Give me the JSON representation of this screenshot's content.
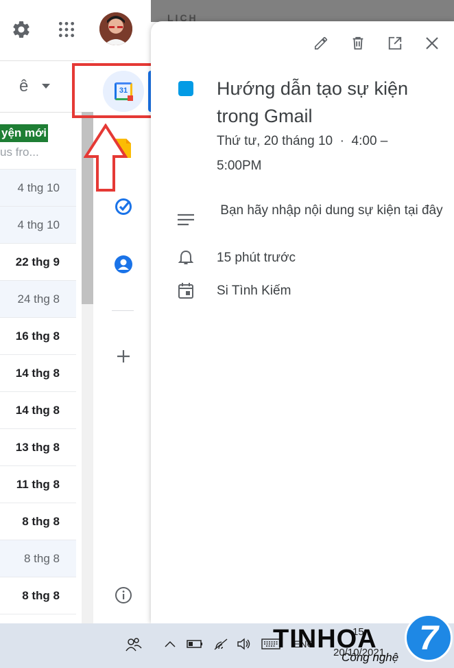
{
  "gmail_header": {
    "settings_icon": "gear-icon",
    "apps_icon": "apps-grid-icon",
    "avatar_icon": "user-avatar",
    "input_tools_label": "ê",
    "input_tools_dropdown_icon": "caret-down-icon"
  },
  "email_list": {
    "label_badge": "yện mới",
    "snippet": "us fro...",
    "rows": [
      {
        "date": "4 thg 10",
        "bold": false
      },
      {
        "date": "4 thg 10",
        "bold": false
      },
      {
        "date": "22 thg 9",
        "bold": true
      },
      {
        "date": "24 thg 8",
        "bold": false
      },
      {
        "date": "16 thg 8",
        "bold": true
      },
      {
        "date": "14 thg 8",
        "bold": true
      },
      {
        "date": "14 thg 8",
        "bold": true
      },
      {
        "date": "13 thg 8",
        "bold": true
      },
      {
        "date": "11 thg 8",
        "bold": true
      },
      {
        "date": "8 thg 8",
        "bold": true
      },
      {
        "date": "8 thg 8",
        "bold": false
      },
      {
        "date": "8 thg 8",
        "bold": true
      }
    ]
  },
  "side_panel": {
    "calendar_icon_label": "31",
    "apps": [
      "google-calendar-icon",
      "google-keep-icon",
      "google-tasks-icon",
      "google-contacts-icon"
    ],
    "add_icon": "plus-icon",
    "info_icon": "info-icon"
  },
  "panel_header": {
    "title": "LỊCH"
  },
  "event": {
    "title": "Hướng dẫn tạo sự kiện trong Gmail",
    "color": "#039be5",
    "datetime_line1": "Thứ tư, 20 tháng 10  ·  4:00 –",
    "datetime_line2": "5:00PM",
    "description": " Bạn hãy nhập nội dung sự kiện tại đây",
    "reminder": "15 phút trước",
    "calendar_owner": "Si Tình Kiếm",
    "actions": [
      "edit-icon",
      "delete-icon",
      "open-in-new-icon",
      "close-icon"
    ]
  },
  "taskbar": {
    "brand_text": "TINHOA",
    "brand_number": "7",
    "brand_subtitle": "Công nghệ",
    "tray_time": "15:",
    "tray_date": "20/10/2021",
    "tray_lang": "ENG"
  },
  "annotation": {
    "highlight_color": "#e53935"
  }
}
